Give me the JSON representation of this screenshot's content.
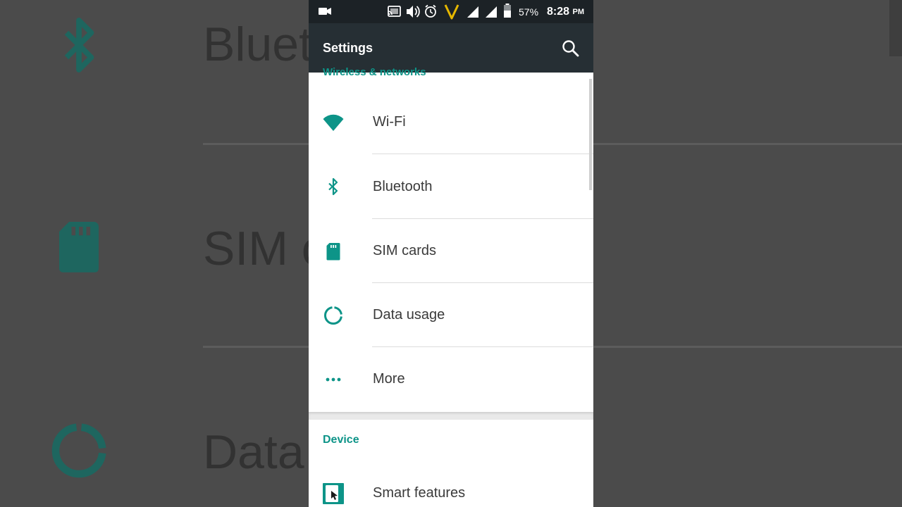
{
  "colors": {
    "accent": "#0d9488",
    "toolbar": "#262f34",
    "status_bar": "#1c2226"
  },
  "background": {
    "rows": [
      {
        "icon": "bluetooth-icon",
        "text": "Bluet"
      },
      {
        "icon": "sim-card-icon",
        "text": "SIM c"
      },
      {
        "icon": "data-usage-icon",
        "text": "Data"
      }
    ]
  },
  "status_bar": {
    "icons": [
      "video-camera-icon",
      "cast-icon",
      "volume-icon",
      "alarm-icon",
      "vodafone-icon",
      "signal-icon",
      "signal-icon",
      "battery-icon"
    ],
    "battery": "57%",
    "time": "8:28",
    "ampm": "PM"
  },
  "toolbar": {
    "title": "Settings",
    "search_icon": "search-icon"
  },
  "sections": {
    "wireless_header": "Wireless & networks",
    "device_header": "Device"
  },
  "items": [
    {
      "label": "Wi-Fi",
      "icon": "wifi-icon"
    },
    {
      "label": "Bluetooth",
      "icon": "bluetooth-icon"
    },
    {
      "label": "SIM cards",
      "icon": "sim-card-icon"
    },
    {
      "label": "Data usage",
      "icon": "data-usage-icon"
    },
    {
      "label": "More",
      "icon": "more-icon"
    },
    {
      "label": "Smart features",
      "icon": "smart-features-icon"
    }
  ]
}
